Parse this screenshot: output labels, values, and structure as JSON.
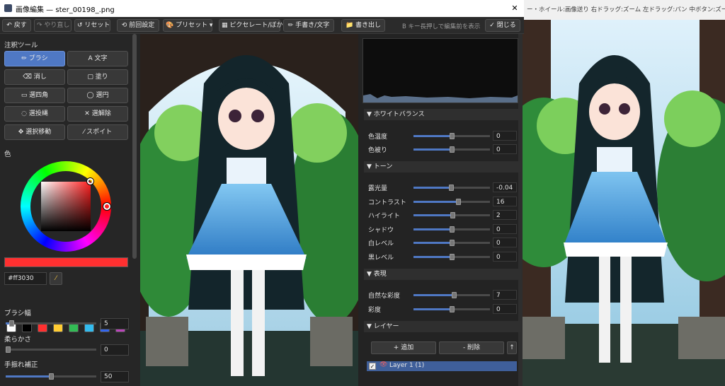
{
  "background_window": {
    "help_text": "ー・ホイール:画像送り 右ドラッグ:ズーム 左ドラッグ:パン 中ボタン:ズームリ..."
  },
  "window": {
    "title": "画像編集 — ster_00198_.png",
    "close_glyph": "✕"
  },
  "toolbar": {
    "undo": "↶ 戻す",
    "redo": "↷ やり直し",
    "reset": "↺ リセット",
    "prev_settings": "⟲ 前回設定",
    "presets": "🎨 プリセット ▾",
    "pixelate_blur": "▦ ピクセレート/ぼかし",
    "handwrite_text": "✏ 手書き/文字",
    "export": "📁 書き出し",
    "hint": "B キー長押しで編集前を表示",
    "close": "✓ 閉じる"
  },
  "left_panel": {
    "tools_heading": "注釈ツール",
    "tools": [
      {
        "label": "✏ ブラシ",
        "active": true
      },
      {
        "label": "A 文字",
        "active": false
      },
      {
        "label": "⌫ 消し",
        "active": false
      },
      {
        "label": "▢ 塗り",
        "active": false
      },
      {
        "label": "▭ 選四角",
        "active": false
      },
      {
        "label": "◯ 選円",
        "active": false
      },
      {
        "label": "◌ 選投縄",
        "active": false
      },
      {
        "label": "✕ 選解除",
        "active": false
      },
      {
        "label": "✥ 選択移動",
        "active": false
      },
      {
        "label": "⁄ スポイト",
        "active": false
      }
    ],
    "color_heading": "色",
    "current_color": "#ff3030",
    "hex_value": "#ff3030",
    "swatches": [
      "#ffffff",
      "#000000",
      "#ff3030",
      "#ffcc33",
      "#33bb55",
      "#33bbee",
      "#3366ee",
      "#bb44bb"
    ],
    "brush_width_label": "ブラシ幅",
    "brush_width": "5",
    "softness_label": "柔らかさ",
    "softness": "0",
    "stabilizer_label": "手振れ補正",
    "stabilizer": "50"
  },
  "right_panel": {
    "sections": {
      "white_balance": "▼ ホワイトバランス",
      "tone": "▼ トーン",
      "expression": "▼ 表現",
      "layers": "▼ レイヤー"
    },
    "sliders": {
      "temperature": {
        "label": "色温度",
        "value": "0",
        "level": 0.5
      },
      "tint": {
        "label": "色被り",
        "value": "0",
        "level": 0.5
      },
      "exposure": {
        "label": "露光量",
        "value": "-0.04",
        "level": 0.49
      },
      "contrast": {
        "label": "コントラスト",
        "value": "16",
        "level": 0.58
      },
      "highlights": {
        "label": "ハイライト",
        "value": "2",
        "level": 0.51
      },
      "shadows": {
        "label": "シャドウ",
        "value": "0",
        "level": 0.5
      },
      "whites": {
        "label": "白レベル",
        "value": "0",
        "level": 0.5
      },
      "blacks": {
        "label": "黒レベル",
        "value": "0",
        "level": 0.5
      },
      "vibrance": {
        "label": "自然な彩度",
        "value": "7",
        "level": 0.53
      },
      "saturation": {
        "label": "彩度",
        "value": "0",
        "level": 0.5
      }
    },
    "layer_add": "+ 追加",
    "layer_delete": "- 削除",
    "layer_up": "↑",
    "layers": [
      {
        "name": "Layer 1 (1)",
        "visible": true,
        "checked": true
      }
    ]
  },
  "colors": {
    "accent": "#4f78c4",
    "panel_bg": "#262626",
    "brush_color": "#ff3030"
  }
}
